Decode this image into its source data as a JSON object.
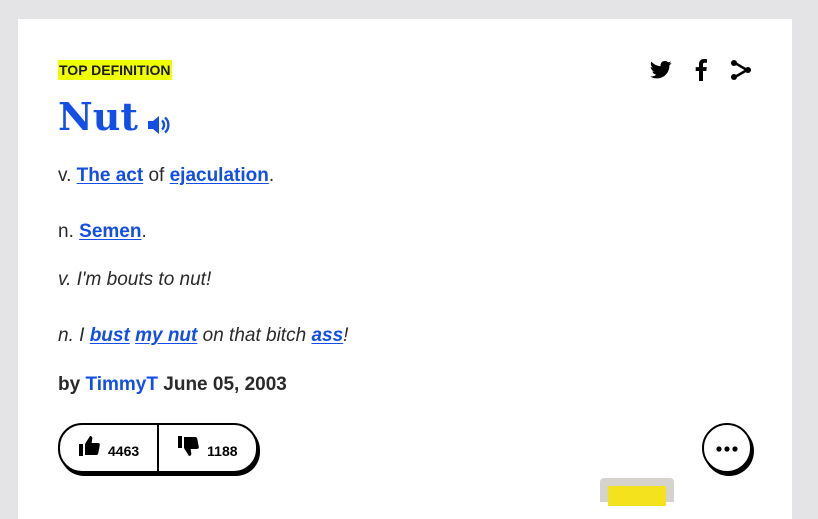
{
  "badge": "TOP DEFINITION",
  "word": "Nut",
  "share_icons": [
    "twitter-icon",
    "facebook-icon",
    "share-icon"
  ],
  "meanings": [
    {
      "pos": "v.",
      "parts": [
        {
          "t": "link",
          "v": "The act"
        },
        {
          "t": "text",
          "v": " of "
        },
        {
          "t": "link",
          "v": "ejaculation"
        },
        {
          "t": "text",
          "v": "."
        }
      ]
    },
    {
      "pos": "n.",
      "parts": [
        {
          "t": "link",
          "v": "Semen"
        },
        {
          "t": "text",
          "v": "."
        }
      ]
    }
  ],
  "examples": [
    {
      "parts": [
        {
          "t": "text",
          "v": "v. I'm bouts to nut!"
        }
      ]
    },
    {
      "parts": [
        {
          "t": "text",
          "v": "n. I "
        },
        {
          "t": "link",
          "v": "bust"
        },
        {
          "t": "text",
          "v": " "
        },
        {
          "t": "link",
          "v": "my nut"
        },
        {
          "t": "text",
          "v": " on that bitch "
        },
        {
          "t": "link",
          "v": "ass"
        },
        {
          "t": "text",
          "v": "!"
        }
      ]
    }
  ],
  "byline": {
    "prefix": "by",
    "author": "TimmyT",
    "date": "June 05, 2003"
  },
  "votes": {
    "up": "4463",
    "down": "1188"
  },
  "colors": {
    "accent": "#134fe6",
    "badge_bg": "#efff00",
    "background": "#e4e4e7"
  }
}
